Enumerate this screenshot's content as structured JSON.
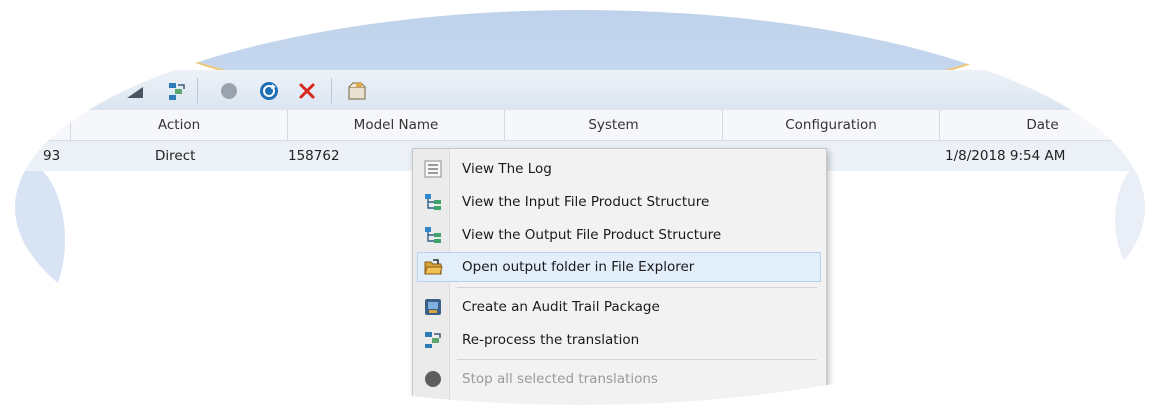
{
  "toolbar": {
    "icons": [
      "partial-icon",
      "reprocess-icon",
      "stop-icon",
      "refresh-icon",
      "delete-icon",
      "package-icon"
    ]
  },
  "grid": {
    "columns": [
      "Action",
      "Model Name",
      "System",
      "Configuration",
      "Date"
    ],
    "rows": [
      {
        "id": "93",
        "action": "Direct",
        "model_name": "158762",
        "date": "1/8/2018 9:54 AM"
      }
    ]
  },
  "context_menu": {
    "items": [
      {
        "label": "View The Log",
        "icon": "log-icon",
        "enabled": true
      },
      {
        "label": "View the Input File Product Structure",
        "icon": "structure-icon",
        "enabled": true
      },
      {
        "label": "View the Output File Product Structure",
        "icon": "structure-icon",
        "enabled": true
      },
      {
        "label": "Open output folder in File Explorer",
        "icon": "folder-icon",
        "enabled": true,
        "highlighted": true
      },
      {
        "label": "Create an Audit Trail Package",
        "icon": "audit-package-icon",
        "enabled": true
      },
      {
        "label": "Re-process the translation",
        "icon": "reprocess-icon",
        "enabled": true
      },
      {
        "label": "Stop all selected translations",
        "icon": "stop-icon",
        "enabled": false
      }
    ]
  }
}
